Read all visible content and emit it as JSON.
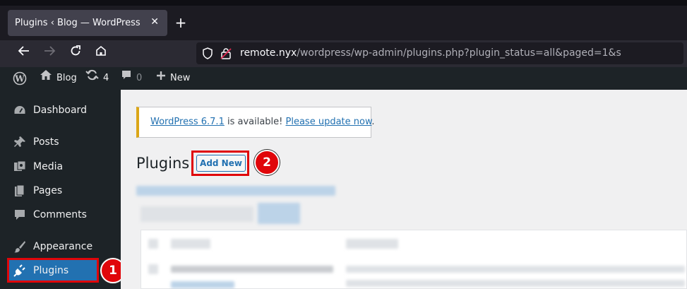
{
  "browser": {
    "tab_title": "Plugins ‹ Blog — WordPress",
    "tab_close": "✕",
    "new_tab": "+",
    "url_host": "remote.nyx",
    "url_path": "/wordpress/wp-admin/plugins.php?plugin_status=all&paged=1&s"
  },
  "admin_bar": {
    "site_name": "Blog",
    "updates_count": "4",
    "comments_count": "0",
    "new_label": "New"
  },
  "sidebar": {
    "items": [
      {
        "label": "Dashboard",
        "icon": "dashboard-icon"
      },
      {
        "label": "Posts",
        "icon": "pin-icon"
      },
      {
        "label": "Media",
        "icon": "media-icon"
      },
      {
        "label": "Pages",
        "icon": "pages-icon"
      },
      {
        "label": "Comments",
        "icon": "comment-icon"
      },
      {
        "label": "Appearance",
        "icon": "brush-icon"
      },
      {
        "label": "Plugins",
        "icon": "plugin-icon",
        "active": true
      }
    ]
  },
  "notice": {
    "version_link": "WordPress 6.7.1",
    "middle_text": " is available! ",
    "update_link": "Please update now",
    "end_text": "."
  },
  "main": {
    "page_title": "Plugins",
    "add_new_label": "Add New"
  },
  "annotations": {
    "badge_1": "1",
    "badge_2": "2"
  },
  "colors": {
    "wp_blue": "#2271b1",
    "admin_dark": "#1d2327",
    "highlight_red": "#e0060a",
    "notice_yellow": "#dba617"
  }
}
